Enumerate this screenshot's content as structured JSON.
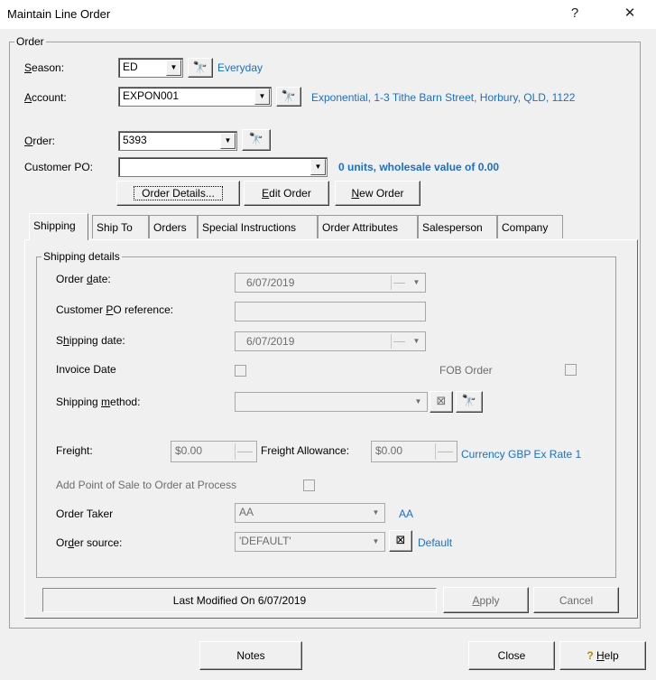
{
  "window": {
    "title": "Maintain Line Order",
    "help_glyph": "?",
    "close_glyph": "✕"
  },
  "order_group": {
    "label": "Order",
    "season": {
      "label_u": "S",
      "label_rest": "eason:",
      "value": "ED",
      "link": "Everyday"
    },
    "account": {
      "label_u": "A",
      "label_rest": "ccount:",
      "value": "EXPON001",
      "link": "Exponential, 1-3 Tithe Barn Street, Horbury, QLD, 1122"
    },
    "order": {
      "label_u": "O",
      "label_rest": "rder:",
      "value": "5393"
    },
    "customer_po": {
      "label": "Customer PO:",
      "value": "",
      "summary": "0 units, wholesale value of 0.00"
    },
    "buttons": {
      "order_details": "Order Details...",
      "edit_order_u": "E",
      "edit_order_rest": "dit Order",
      "new_order_u": "N",
      "new_order_rest": "ew Order"
    }
  },
  "tabs": [
    "Shipping",
    "Ship To",
    "Orders",
    "Special Instructions",
    "Order Attributes",
    "Salesperson",
    "Company"
  ],
  "shipping": {
    "group_label": "Shipping details",
    "order_date": {
      "label_a": "Order ",
      "label_u": "d",
      "label_b": "ate:",
      "value": "6/07/2019"
    },
    "customer_po_ref": {
      "label_a": "Customer ",
      "label_u": "P",
      "label_b": "O reference:",
      "value": ""
    },
    "shipping_date": {
      "label_a": "S",
      "label_u": "h",
      "label_b": "ipping date:",
      "value": "6/07/2019"
    },
    "invoice_date": {
      "label": "Invoice Date"
    },
    "fob_order": {
      "label": "FOB Order"
    },
    "shipping_method": {
      "label_a": "Shipping ",
      "label_u": "m",
      "label_b": "ethod:",
      "value": ""
    },
    "freight": {
      "label": "Freight:",
      "value": "$0.00"
    },
    "freight_allowance": {
      "label": "Freight Allowance:",
      "value": "$0.00"
    },
    "currency_link": "Currency GBP Ex Rate 1",
    "add_pos": {
      "label": "Add Point of Sale to Order at Process"
    },
    "order_taker": {
      "label": "Order Taker",
      "value": "AA",
      "link": "AA"
    },
    "order_source": {
      "label_a": "Or",
      "label_u": "d",
      "label_b": "er source:",
      "value": "'DEFAULT'",
      "link": "Default"
    }
  },
  "status": {
    "last_modified": "Last Modified On 6/07/2019",
    "apply_u": "A",
    "apply_rest": "pply",
    "cancel": "Cancel"
  },
  "footer": {
    "notes": "Notes",
    "close": "Close",
    "help_u": "H",
    "help_rest": "elp"
  }
}
